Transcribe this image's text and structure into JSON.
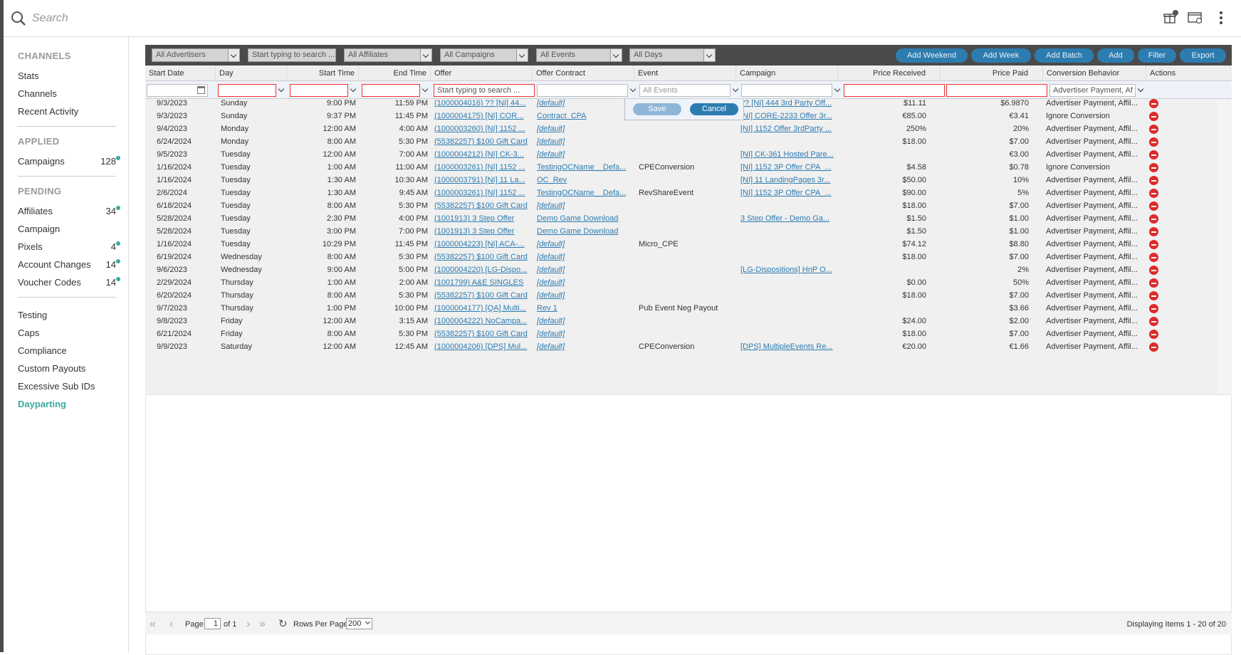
{
  "search": {
    "placeholder": "Search"
  },
  "sidebar": {
    "sections": [
      {
        "title": "CHANNELS",
        "items": [
          {
            "label": "Stats"
          },
          {
            "label": "Channels"
          },
          {
            "label": "Recent Activity"
          }
        ]
      },
      {
        "title": "APPLIED",
        "items": [
          {
            "label": "Campaigns",
            "count": "128"
          }
        ]
      },
      {
        "title": "PENDING",
        "items": [
          {
            "label": "Affiliates",
            "count": "34"
          },
          {
            "label": "Campaign"
          },
          {
            "label": "Pixels",
            "count": "4"
          },
          {
            "label": "Account Changes",
            "count": "14"
          },
          {
            "label": "Voucher Codes",
            "count": "14"
          }
        ]
      }
    ],
    "tools": [
      {
        "label": "Testing"
      },
      {
        "label": "Caps"
      },
      {
        "label": "Compliance"
      },
      {
        "label": "Custom Payouts"
      },
      {
        "label": "Excessive Sub IDs"
      },
      {
        "label": "Dayparting",
        "active": true
      }
    ]
  },
  "toolbar": {
    "filters": [
      "All Advertisers",
      "Start typing to search ...",
      "All Affiliates",
      "All Campaigns",
      "All Events",
      "All Days"
    ],
    "buttons": [
      "Add Weekend",
      "Add Week",
      "Add Batch",
      "Add",
      "Filter",
      "Export"
    ]
  },
  "columns": [
    "Start Date",
    "Day",
    "Start Time",
    "End Time",
    "Offer",
    "Offer Contract",
    "Event",
    "Campaign",
    "Price Received",
    "Price Paid",
    "Conversion Behavior",
    "Actions"
  ],
  "filter_row": {
    "offer_placeholder": "Start typing to search ...",
    "event_value": "All Events",
    "conversion_value": "Advertiser Payment, Af"
  },
  "popup": {
    "save": "Save",
    "cancel": "Cancel"
  },
  "rows": [
    [
      "9/3/2023",
      "Sunday",
      "9:00 PM",
      "11:59 PM",
      "(1000004016) ?? [NI] 44...",
      "[default]",
      "",
      "?? [NI] 444 3rd Party Off...",
      "$11.11",
      "$6.9870",
      "Advertiser Payment, Affil..."
    ],
    [
      "9/3/2023",
      "Sunday",
      "9:37 PM",
      "11:45 PM",
      "(1000004175) [NI] COR...",
      "Contract_CPA",
      "",
      "[NI] CORE-2233 Offer 3r...",
      "€85.00",
      "€3.41",
      "Ignore Conversion"
    ],
    [
      "9/4/2023",
      "Monday",
      "12:00 AM",
      "4:00 AM",
      "(1000003260) [NI] 1152 ...",
      "[default]",
      "",
      "[NI] 1152 Offer 3rdParty ...",
      "250%",
      "20%",
      "Advertiser Payment, Affil..."
    ],
    [
      "6/24/2024",
      "Monday",
      "8:00 AM",
      "5:30 PM",
      "(55382257) $100 Gift Card",
      "[default]",
      "",
      "",
      "$18.00",
      "$7.00",
      "Advertiser Payment, Affil..."
    ],
    [
      "9/5/2023",
      "Tuesday",
      "12:00 AM",
      "7:00 AM",
      "(1000004212) [NI] CK-3...",
      "[default]",
      "",
      "[NI] CK-361 Hosted Pare...",
      "",
      "€3.00",
      "Advertiser Payment, Affil..."
    ],
    [
      "1/16/2024",
      "Tuesday",
      "1:00 AM",
      "11:00 AM",
      "(1000003261) [NI] 1152 ...",
      "TestingOCName__Defa...",
      "CPEConversion",
      "[NI] 1152 3P Offer CPA_...",
      "$4.58",
      "$0.78",
      "Ignore Conversion"
    ],
    [
      "1/16/2024",
      "Tuesday",
      "1:30 AM",
      "10:30 AM",
      "(1000003791) [NI] 11 La...",
      "OC_Rev",
      "",
      "[NI] 11 LandingPages 3r...",
      "$50.00",
      "10%",
      "Advertiser Payment, Affil..."
    ],
    [
      "2/6/2024",
      "Tuesday",
      "1:30 AM",
      "9:45 AM",
      "(1000003261) [NI] 1152 ...",
      "TestingOCName__Defa...",
      "RevShareEvent",
      "[NI] 1152 3P Offer CPA_...",
      "$90.00",
      "5%",
      "Advertiser Payment, Affil..."
    ],
    [
      "6/18/2024",
      "Tuesday",
      "8:00 AM",
      "5:30 PM",
      "(55382257) $100 Gift Card",
      "[default]",
      "",
      "",
      "$18.00",
      "$7.00",
      "Advertiser Payment, Affil..."
    ],
    [
      "5/28/2024",
      "Tuesday",
      "2:30 PM",
      "4:00 PM",
      "(1001913) 3 Step Offer",
      "Demo Game Download",
      "",
      "3 Step Offer - Demo Ga...",
      "$1.50",
      "$1.00",
      "Advertiser Payment, Affil..."
    ],
    [
      "5/28/2024",
      "Tuesday",
      "3:00 PM",
      "7:00 PM",
      "(1001913) 3 Step Offer",
      "Demo Game Download",
      "",
      "",
      "$1.50",
      "$1.00",
      "Advertiser Payment, Affil..."
    ],
    [
      "1/16/2024",
      "Tuesday",
      "10:29 PM",
      "11:45 PM",
      "(1000004223) [NI] ACA-...",
      "[default]",
      "Micro_CPE",
      "",
      "$74.12",
      "$8.80",
      "Advertiser Payment, Affil..."
    ],
    [
      "6/19/2024",
      "Wednesday",
      "8:00 AM",
      "5:30 PM",
      "(55382257) $100 Gift Card",
      "[default]",
      "",
      "",
      "$18.00",
      "$7.00",
      "Advertiser Payment, Affil..."
    ],
    [
      "9/6/2023",
      "Wednesday",
      "9:00 AM",
      "5:00 PM",
      "(1000004220) [LG-Dispo...",
      "[default]",
      "",
      "[LG-Dispositions] HnP O...",
      "",
      "2%",
      "Advertiser Payment, Affil..."
    ],
    [
      "2/29/2024",
      "Thursday",
      "1:00 AM",
      "2:00 AM",
      "(1001799) A&E SINGLES",
      "[default]",
      "",
      "",
      "$0.00",
      "50%",
      "Advertiser Payment, Affil..."
    ],
    [
      "6/20/2024",
      "Thursday",
      "8:00 AM",
      "5:30 PM",
      "(55382257) $100 Gift Card",
      "[default]",
      "",
      "",
      "$18.00",
      "$7.00",
      "Advertiser Payment, Affil..."
    ],
    [
      "9/7/2023",
      "Thursday",
      "1:00 PM",
      "10:00 PM",
      "(1000004177) [QA] Multi...",
      "Rev 1",
      "Pub Event Neg Payout",
      "",
      "",
      "$3.66",
      "Advertiser Payment, Affil..."
    ],
    [
      "9/8/2023",
      "Friday",
      "12:00 AM",
      "3:15 AM",
      "(1000004222) NoCampa...",
      "[default]",
      "",
      "",
      "$24.00",
      "$2.00",
      "Advertiser Payment, Affil..."
    ],
    [
      "6/21/2024",
      "Friday",
      "8:00 AM",
      "5:30 PM",
      "(55382257) $100 Gift Card",
      "[default]",
      "",
      "",
      "$18.00",
      "$7.00",
      "Advertiser Payment, Affil..."
    ],
    [
      "9/9/2023",
      "Saturday",
      "12:00 AM",
      "12:45 AM",
      "(1000004206) [DPS] Mul...",
      "[default]",
      "CPEConversion",
      "[DPS] MultipleEvents Re...",
      "€20.00",
      "€1.66",
      "Advertiser Payment, Affil..."
    ]
  ],
  "footer": {
    "page_label": "Page",
    "page_value": "1",
    "of_label": "of 1",
    "rows_label": "Rows Per Page:",
    "rows_value": "200",
    "display": "Displaying Items 1 - 20 of 20"
  }
}
